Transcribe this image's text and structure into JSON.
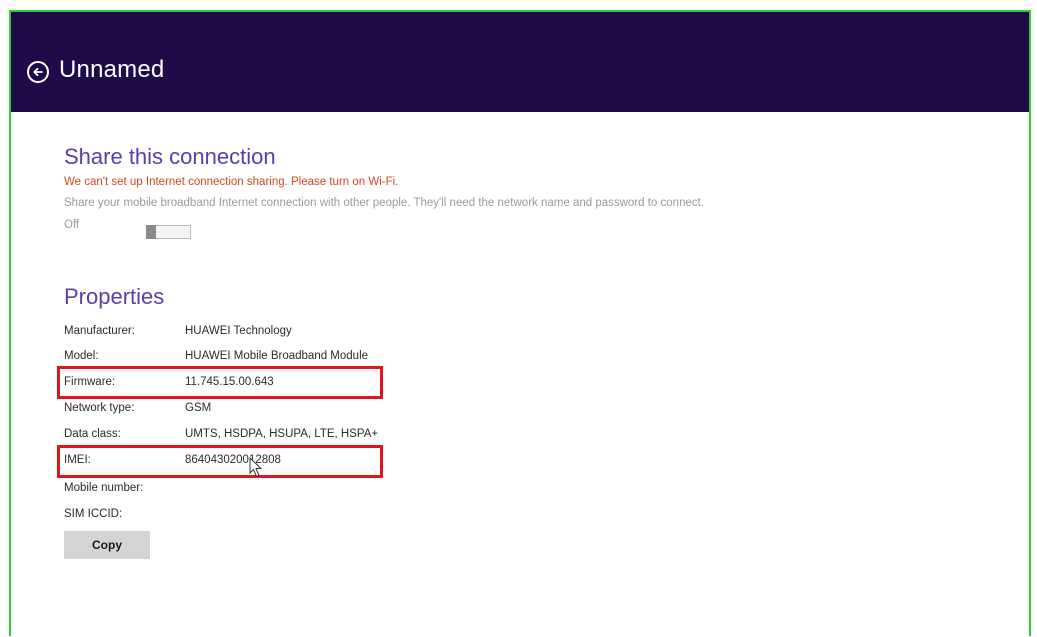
{
  "header": {
    "title": "Unnamed",
    "back_icon": "back-arrow-circle-icon",
    "background": "#1d0b4a"
  },
  "share": {
    "title": "Share this connection",
    "warning": "We can't set up Internet connection sharing. Please turn on Wi-Fi.",
    "description": "Share your mobile broadband Internet connection with other people. They'll need the network name and password to connect.",
    "toggle_label": "Off",
    "toggle_state": "off"
  },
  "properties": {
    "title": "Properties",
    "rows": [
      {
        "key": "Manufacturer:",
        "value": "HUAWEI Technology"
      },
      {
        "key": "Model:",
        "value": "HUAWEI Mobile Broadband Module"
      },
      {
        "key": "Firmware:",
        "value": "11.745.15.00.643"
      },
      {
        "key": "Network type:",
        "value": "GSM"
      },
      {
        "key": "Data class:",
        "value": "UMTS, HSDPA, HSUPA, LTE, HSPA+"
      },
      {
        "key": "IMEI:",
        "value": "864043020012808"
      },
      {
        "key": "Mobile number:",
        "value": ""
      },
      {
        "key": "SIM ICCID:",
        "value": ""
      }
    ],
    "copy_label": "Copy"
  },
  "colors": {
    "accent_title": "#5b3ea6",
    "warning": "#d24a1c",
    "highlight_box": "#e0161c",
    "frame_border": "#33cc33"
  }
}
